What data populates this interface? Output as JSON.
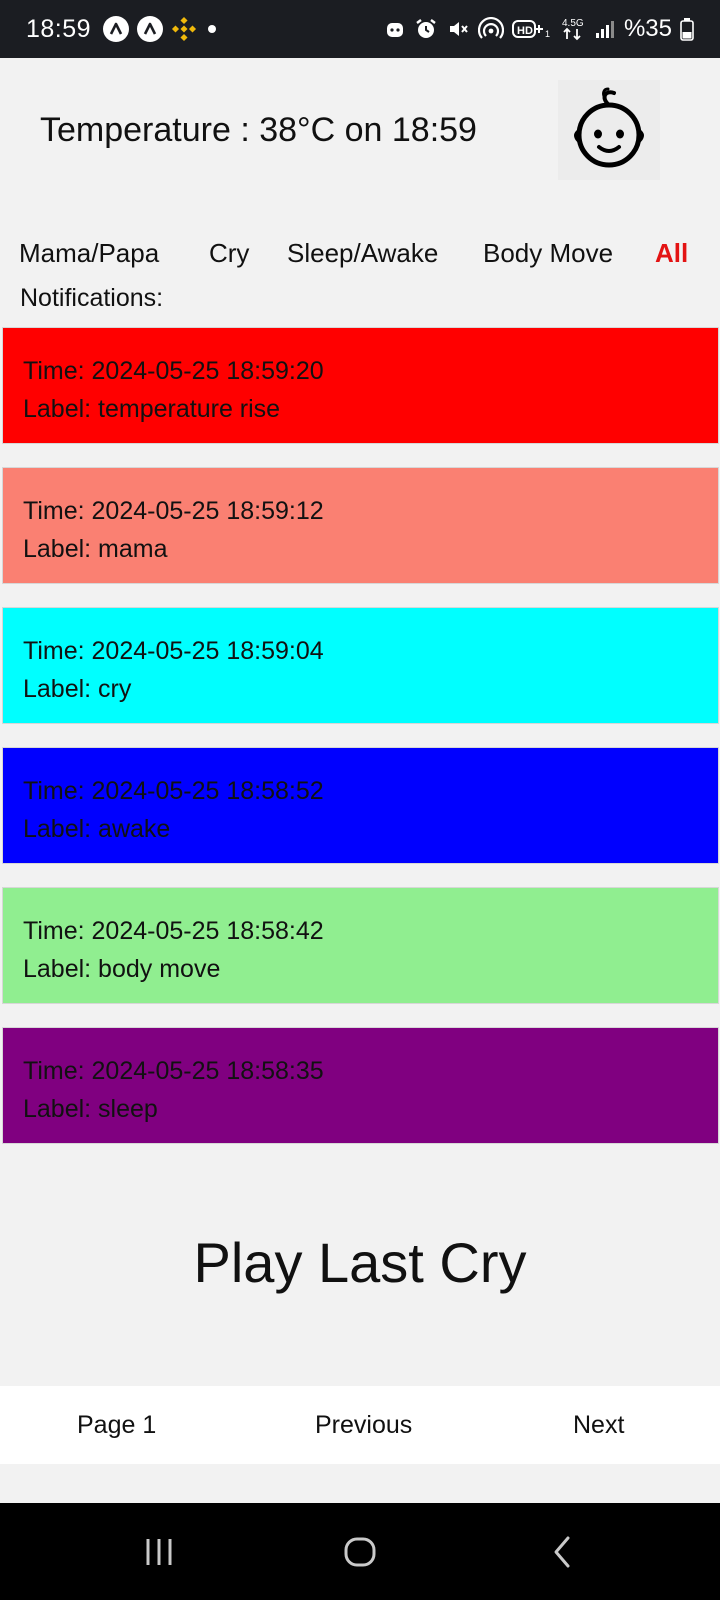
{
  "status_bar": {
    "time": "18:59",
    "battery": "%35",
    "network": "4.5G",
    "icons": [
      "app-a-icon",
      "app-a-icon",
      "binance-icon",
      "dot-icon",
      "robot-icon",
      "alarm-icon",
      "mute-icon",
      "hotspot-icon",
      "hd-plus-icon",
      "network-arrows-icon",
      "signal-icon",
      "battery-icon"
    ]
  },
  "header": {
    "temperature": "Temperature : 38°C on 18:59",
    "avatar_icon": "baby-face-icon"
  },
  "filters": [
    {
      "label": "Mama/Papa",
      "active": false
    },
    {
      "label": "Cry",
      "active": false
    },
    {
      "label": "Sleep/Awake",
      "active": false
    },
    {
      "label": "Body Move",
      "active": false
    },
    {
      "label": "All",
      "active": true
    }
  ],
  "notifications_title": "Notifications:",
  "notifications": [
    {
      "time": "Time: 2024-05-25 18:59:20",
      "label": "Label: temperature rise",
      "color": "#ff0000"
    },
    {
      "time": "Time: 2024-05-25 18:59:12",
      "label": "Label: mama",
      "color": "#fa8072"
    },
    {
      "time": "Time: 2024-05-25 18:59:04",
      "label": "Label: cry",
      "color": "#00ffff"
    },
    {
      "time": "Time: 2024-05-25 18:58:52",
      "label": "Label: awake",
      "color": "#0000ff"
    },
    {
      "time": "Time: 2024-05-25 18:58:42",
      "label": "Label: body move",
      "color": "#90ee90"
    },
    {
      "time": "Time: 2024-05-25 18:58:35",
      "label": "Label: sleep",
      "color": "#800080"
    }
  ],
  "play_button": "Play Last Cry",
  "pager": {
    "page": "Page 1",
    "previous": "Previous",
    "next": "Next"
  },
  "nav_bar": [
    "recents-icon",
    "home-icon",
    "back-icon"
  ]
}
